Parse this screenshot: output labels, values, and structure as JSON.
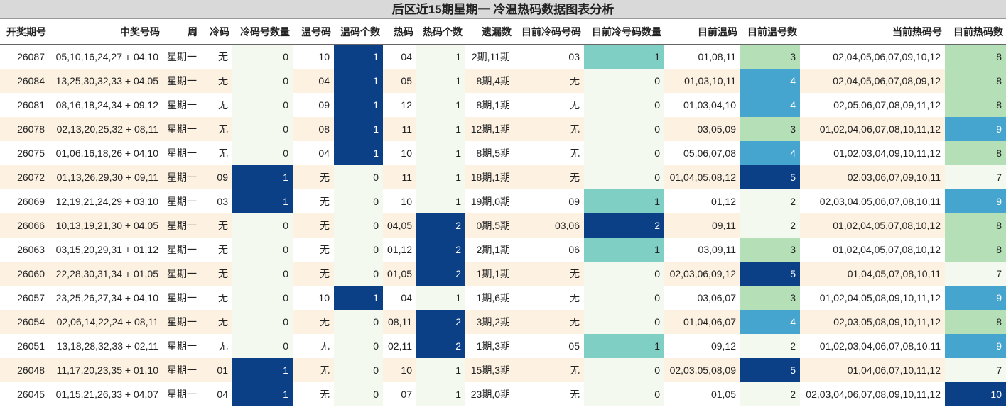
{
  "title": "后区近15期星期一 冷温热码数据图表分析",
  "headers": [
    "开奖期号",
    "中奖号码",
    "周",
    "冷码",
    "冷码号数量",
    "温号码",
    "温码个数",
    "热码",
    "热码个数",
    "遗漏数",
    "目前冷码号码",
    "目前冷号码数量",
    "目前温码",
    "目前温号数",
    "当前热码号",
    "目前热码数"
  ],
  "rows": [
    [
      "26087",
      "05,10,16,24,27 + 04,10",
      "星期一",
      "无",
      "0",
      "10",
      "1",
      "04",
      "1",
      "2期,11期",
      "03",
      "1",
      "01,08,11",
      "3",
      "02,04,05,06,07,09,10,12",
      "8"
    ],
    [
      "26084",
      "13,25,30,32,33 + 04,05",
      "星期一",
      "无",
      "0",
      "04",
      "1",
      "05",
      "1",
      "8期,4期",
      "无",
      "0",
      "01,03,10,11",
      "4",
      "02,04,05,06,07,08,09,12",
      "8"
    ],
    [
      "26081",
      "08,16,18,24,34 + 09,12",
      "星期一",
      "无",
      "0",
      "09",
      "1",
      "12",
      "1",
      "8期,1期",
      "无",
      "0",
      "01,03,04,10",
      "4",
      "02,05,06,07,08,09,11,12",
      "8"
    ],
    [
      "26078",
      "02,13,20,25,32 + 08,11",
      "星期一",
      "无",
      "0",
      "08",
      "1",
      "11",
      "1",
      "12期,1期",
      "无",
      "0",
      "03,05,09",
      "3",
      "01,02,04,06,07,08,10,11,12",
      "9"
    ],
    [
      "26075",
      "01,06,16,18,26 + 04,10",
      "星期一",
      "无",
      "0",
      "04",
      "1",
      "10",
      "1",
      "8期,5期",
      "无",
      "0",
      "05,06,07,08",
      "4",
      "01,02,03,04,09,10,11,12",
      "8"
    ],
    [
      "26072",
      "01,13,26,29,30 + 09,11",
      "星期一",
      "09",
      "1",
      "无",
      "0",
      "11",
      "1",
      "18期,1期",
      "无",
      "0",
      "01,04,05,08,12",
      "5",
      "02,03,06,07,09,10,11",
      "7"
    ],
    [
      "26069",
      "12,19,21,24,29 + 03,10",
      "星期一",
      "03",
      "1",
      "无",
      "0",
      "10",
      "1",
      "19期,0期",
      "09",
      "1",
      "01,12",
      "2",
      "02,03,04,05,06,07,08,10,11",
      "9"
    ],
    [
      "26066",
      "10,13,19,21,30 + 04,05",
      "星期一",
      "无",
      "0",
      "无",
      "0",
      "04,05",
      "2",
      "0期,5期",
      "03,06",
      "2",
      "09,11",
      "2",
      "01,02,04,05,07,08,10,12",
      "8"
    ],
    [
      "26063",
      "03,15,20,29,31 + 01,12",
      "星期一",
      "无",
      "0",
      "无",
      "0",
      "01,12",
      "2",
      "2期,1期",
      "06",
      "1",
      "03,09,11",
      "3",
      "01,02,04,05,07,08,10,12",
      "8"
    ],
    [
      "26060",
      "22,28,30,31,34 + 01,05",
      "星期一",
      "无",
      "0",
      "无",
      "0",
      "01,05",
      "2",
      "1期,1期",
      "无",
      "0",
      "02,03,06,09,12",
      "5",
      "01,04,05,07,08,10,11",
      "7"
    ],
    [
      "26057",
      "23,25,26,27,34 + 04,10",
      "星期一",
      "无",
      "0",
      "10",
      "1",
      "04",
      "1",
      "1期,6期",
      "无",
      "0",
      "03,06,07",
      "3",
      "01,02,04,05,08,09,10,11,12",
      "9"
    ],
    [
      "26054",
      "02,06,14,22,24 + 08,11",
      "星期一",
      "无",
      "0",
      "无",
      "0",
      "08,11",
      "2",
      "3期,2期",
      "无",
      "0",
      "01,04,06,07",
      "4",
      "02,03,05,08,09,10,11,12",
      "8"
    ],
    [
      "26051",
      "13,18,28,32,33 + 02,11",
      "星期一",
      "无",
      "0",
      "无",
      "0",
      "02,11",
      "2",
      "1期,3期",
      "05",
      "1",
      "09,12",
      "2",
      "01,02,03,04,06,07,08,10,11",
      "9"
    ],
    [
      "26048",
      "11,17,20,23,35 + 01,10",
      "星期一",
      "01",
      "1",
      "无",
      "0",
      "10",
      "1",
      "15期,3期",
      "无",
      "0",
      "02,03,05,08,09",
      "5",
      "01,04,06,07,10,11,12",
      "7"
    ],
    [
      "26045",
      "01,15,21,26,33 + 04,07",
      "星期一",
      "04",
      "1",
      "无",
      "0",
      "07",
      "1",
      "23期,0期",
      "无",
      "0",
      "01,05",
      "2",
      "02,03,04,06,07,08,09,10,11,12",
      "10"
    ]
  ]
}
